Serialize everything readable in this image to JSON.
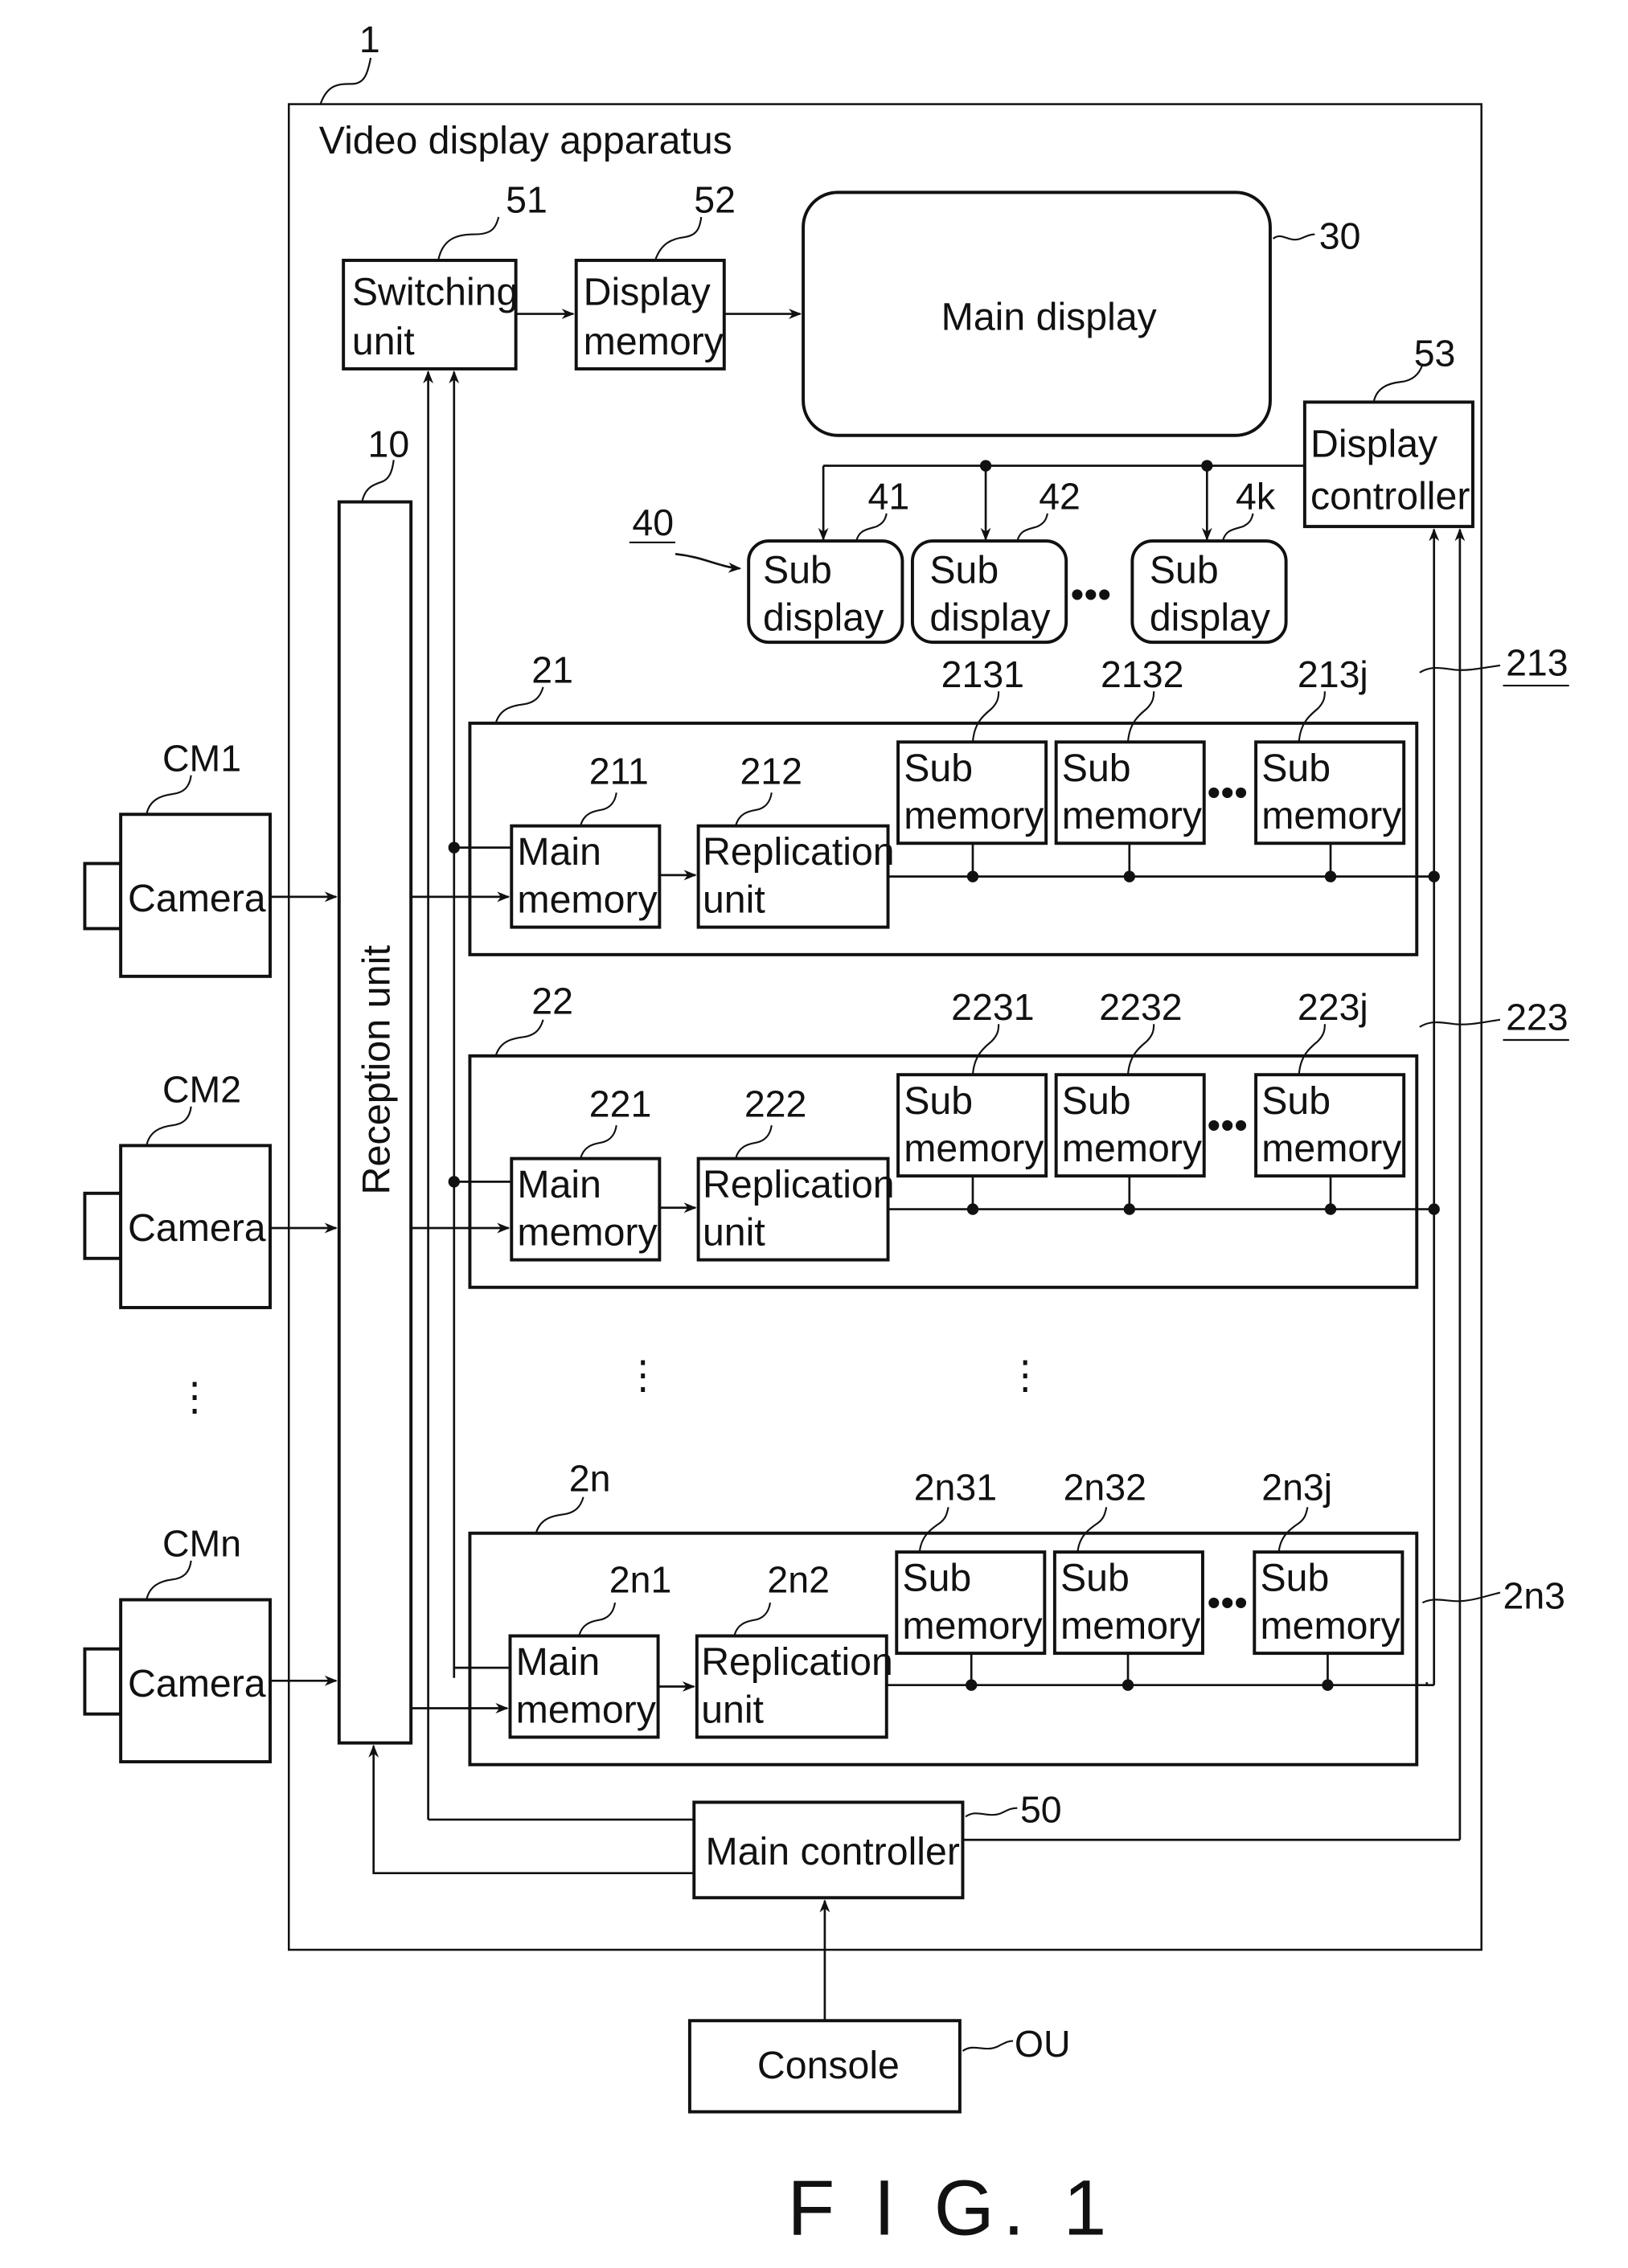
{
  "figure": {
    "caption": "F I G. 1",
    "apparatus": {
      "ref": "1",
      "title": "Video display apparatus"
    },
    "reception_unit": {
      "ref": "10",
      "label": "Reception unit"
    },
    "switching_unit": {
      "ref": "51",
      "line1": "Switching",
      "line2": "unit"
    },
    "display_memory": {
      "ref": "52",
      "line1": "Display",
      "line2": "memory"
    },
    "main_display": {
      "ref": "30",
      "label": "Main display"
    },
    "display_controller": {
      "ref": "53",
      "line1": "Display",
      "line2": "controller"
    },
    "sub_display_group": {
      "ref": "40"
    },
    "sub_displays": [
      {
        "ref": "41",
        "line1": "Sub",
        "line2": "display"
      },
      {
        "ref": "42",
        "line1": "Sub",
        "line2": "display"
      },
      {
        "ref": "4k",
        "line1": "Sub",
        "line2": "display"
      }
    ],
    "ellipsis": "•••",
    "vertical_ellipsis": "⋮",
    "cameras": [
      {
        "ref": "CM1",
        "label": "Camera"
      },
      {
        "ref": "CM2",
        "label": "Camera"
      },
      {
        "ref": "CMn",
        "label": "Camera"
      }
    ],
    "memory_blocks": [
      {
        "ref": "21",
        "bus_ref": "213",
        "main_memory": {
          "ref": "211",
          "line1": "Main",
          "line2": "memory"
        },
        "replication_unit": {
          "ref": "212",
          "line1": "Replication",
          "line2": "unit"
        },
        "sub_memories": [
          {
            "ref": "2131",
            "line1": "Sub",
            "line2": "memory"
          },
          {
            "ref": "2132",
            "line1": "Sub",
            "line2": "memory"
          },
          {
            "ref": "213j",
            "line1": "Sub",
            "line2": "memory"
          }
        ]
      },
      {
        "ref": "22",
        "bus_ref": "223",
        "main_memory": {
          "ref": "221",
          "line1": "Main",
          "line2": "memory"
        },
        "replication_unit": {
          "ref": "222",
          "line1": "Replication",
          "line2": "unit"
        },
        "sub_memories": [
          {
            "ref": "2231",
            "line1": "Sub",
            "line2": "memory"
          },
          {
            "ref": "2232",
            "line1": "Sub",
            "line2": "memory"
          },
          {
            "ref": "223j",
            "line1": "Sub",
            "line2": "memory"
          }
        ]
      },
      {
        "ref": "2n",
        "bus_ref": "2n3",
        "main_memory": {
          "ref": "2n1",
          "line1": "Main",
          "line2": "memory"
        },
        "replication_unit": {
          "ref": "2n2",
          "line1": "Replication",
          "line2": "unit"
        },
        "sub_memories": [
          {
            "ref": "2n31",
            "line1": "Sub",
            "line2": "memory"
          },
          {
            "ref": "2n32",
            "line1": "Sub",
            "line2": "memory"
          },
          {
            "ref": "2n3j",
            "line1": "Sub",
            "line2": "memory"
          }
        ]
      }
    ],
    "main_controller": {
      "ref": "50",
      "label": "Main controller"
    },
    "console": {
      "ref": "OU",
      "label": "Console"
    }
  }
}
